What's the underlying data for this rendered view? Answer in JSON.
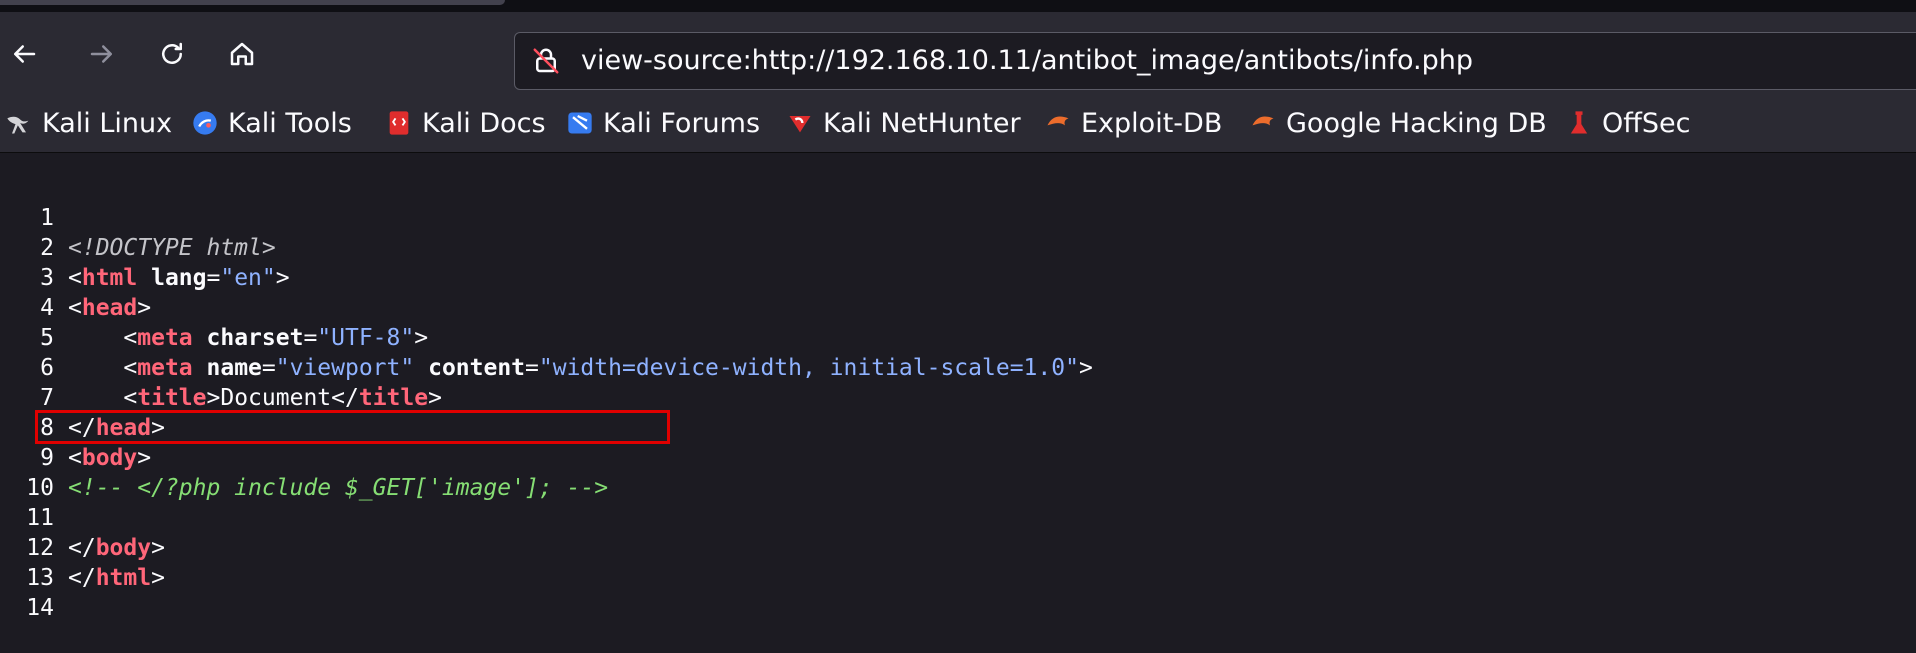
{
  "nav": {
    "back_icon": "back-arrow-icon",
    "forward_icon": "forward-arrow-icon",
    "reload_icon": "reload-icon",
    "home_icon": "home-icon",
    "url": "view-source:http://192.168.10.11/antibot_image/antibots/info.php"
  },
  "bookmarks": [
    {
      "label": "Kali Linux",
      "icon": "kali-dragon-icon"
    },
    {
      "label": "Kali Tools",
      "icon": "kali-tools-icon"
    },
    {
      "label": "Kali Docs",
      "icon": "kali-docs-icon"
    },
    {
      "label": "Kali Forums",
      "icon": "kali-forums-icon"
    },
    {
      "label": "Kali NetHunter",
      "icon": "kali-nethunter-icon"
    },
    {
      "label": "Exploit-DB",
      "icon": "exploit-db-icon"
    },
    {
      "label": "Google Hacking DB",
      "icon": "ghdb-icon"
    },
    {
      "label": "OffSec",
      "icon": "offsec-icon"
    }
  ],
  "source": {
    "line_numbers": [
      "1",
      "2",
      "3",
      "4",
      "5",
      "6",
      "7",
      "8",
      "9",
      "10",
      "11",
      "12",
      "13",
      "14"
    ],
    "l1": "<!DOCTYPE html>",
    "l2": {
      "open": "<",
      "tag": "html",
      "attr": "lang",
      "eq": "=",
      "val": "\"en\"",
      "close": ">"
    },
    "l3": {
      "open": "<",
      "tag": "head",
      "close": ">"
    },
    "l4": {
      "indent": "    <",
      "tag": "meta",
      "attr": "charset",
      "eq": "=",
      "val": "\"UTF-8\"",
      "close": ">"
    },
    "l5": {
      "indent": "    <",
      "tag": "meta",
      "attr1": "name",
      "eq": "=",
      "val1": "\"viewport\"",
      "attr2": "content",
      "val2": "\"width=device-width, initial-scale=1.0\"",
      "close": ">"
    },
    "l6": {
      "indent": "    <",
      "tag": "title",
      "gt": ">",
      "text": "Document",
      "lt": "</",
      "tag2": "title",
      "close": ">"
    },
    "l7": {
      "open": "</",
      "tag": "head",
      "close": ">"
    },
    "l8": {
      "open": "<",
      "tag": "body",
      "close": ">"
    },
    "l9": "<!-- </?php include $_GET['image']; -->",
    "l11": {
      "open": "</",
      "tag": "body",
      "close": ">"
    },
    "l12": {
      "open": "</",
      "tag": "html",
      "close": ">"
    }
  }
}
